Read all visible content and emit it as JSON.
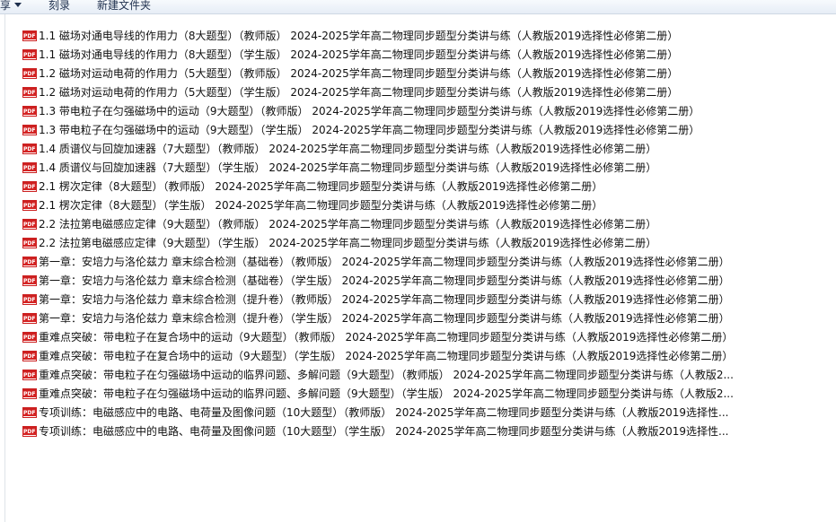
{
  "toolbar": {
    "share_label": "享",
    "burn_label": "刻录",
    "new_folder_label": "新建文件夹"
  },
  "files": [
    {
      "name": "1.1 磁场对通电导线的作用力（8大题型）（教师版） 2024-2025学年高二物理同步题型分类讲与练（人教版2019选择性必修第二册）",
      "icon": "pdf-icon"
    },
    {
      "name": "1.1 磁场对通电导线的作用力（8大题型）（学生版） 2024-2025学年高二物理同步题型分类讲与练（人教版2019选择性必修第二册）",
      "icon": "pdf-icon"
    },
    {
      "name": "1.2 磁场对运动电荷的作用力（5大题型）（教师版） 2024-2025学年高二物理同步题型分类讲与练（人教版2019选择性必修第二册）",
      "icon": "pdf-icon"
    },
    {
      "name": "1.2 磁场对运动电荷的作用力（5大题型）（学生版） 2024-2025学年高二物理同步题型分类讲与练（人教版2019选择性必修第二册）",
      "icon": "pdf-icon"
    },
    {
      "name": "1.3 带电粒子在匀强磁场中的运动（9大题型）（教师版） 2024-2025学年高二物理同步题型分类讲与练（人教版2019选择性必修第二册）",
      "icon": "pdf-icon"
    },
    {
      "name": "1.3 带电粒子在匀强磁场中的运动（9大题型）（学生版） 2024-2025学年高二物理同步题型分类讲与练（人教版2019选择性必修第二册）",
      "icon": "pdf-icon"
    },
    {
      "name": "1.4 质谱仪与回旋加速器（7大题型）（教师版） 2024-2025学年高二物理同步题型分类讲与练（人教版2019选择性必修第二册）",
      "icon": "pdf-icon"
    },
    {
      "name": "1.4 质谱仪与回旋加速器（7大题型）（学生版） 2024-2025学年高二物理同步题型分类讲与练（人教版2019选择性必修第二册）",
      "icon": "pdf-icon"
    },
    {
      "name": "2.1 楞次定律（8大题型）（教师版） 2024-2025学年高二物理同步题型分类讲与练（人教版2019选择性必修第二册）",
      "icon": "pdf-icon"
    },
    {
      "name": "2.1 楞次定律（8大题型）（学生版） 2024-2025学年高二物理同步题型分类讲与练（人教版2019选择性必修第二册）",
      "icon": "pdf-icon"
    },
    {
      "name": "2.2 法拉第电磁感应定律（9大题型）（教师版） 2024-2025学年高二物理同步题型分类讲与练（人教版2019选择性必修第二册）",
      "icon": "pdf-icon"
    },
    {
      "name": "2.2 法拉第电磁感应定律（9大题型）（学生版） 2024-2025学年高二物理同步题型分类讲与练（人教版2019选择性必修第二册）",
      "icon": "pdf-icon"
    },
    {
      "name": "第一章：安培力与洛伦兹力 章末综合检测（基础卷）（教师版） 2024-2025学年高二物理同步题型分类讲与练（人教版2019选择性必修第二册）",
      "icon": "pdf-icon"
    },
    {
      "name": "第一章：安培力与洛伦兹力 章末综合检测（基础卷）（学生版） 2024-2025学年高二物理同步题型分类讲与练（人教版2019选择性必修第二册）",
      "icon": "pdf-icon"
    },
    {
      "name": "第一章：安培力与洛伦兹力 章末综合检测（提升卷）（教师版） 2024-2025学年高二物理同步题型分类讲与练（人教版2019选择性必修第二册）",
      "icon": "pdf-icon"
    },
    {
      "name": "第一章：安培力与洛伦兹力 章末综合检测（提升卷）（学生版） 2024-2025学年高二物理同步题型分类讲与练（人教版2019选择性必修第二册）",
      "icon": "pdf-icon"
    },
    {
      "name": "重难点突破：带电粒子在复合场中的运动（9大题型）（教师版） 2024-2025学年高二物理同步题型分类讲与练（人教版2019选择性必修第二册）",
      "icon": "pdf-icon"
    },
    {
      "name": "重难点突破：带电粒子在复合场中的运动（9大题型）（学生版） 2024-2025学年高二物理同步题型分类讲与练（人教版2019选择性必修第二册）",
      "icon": "pdf-icon"
    },
    {
      "name": "重难点突破：带电粒子在匀强磁场中运动的临界问题、多解问题（9大题型）（教师版） 2024-2025学年高二物理同步题型分类讲与练（人教版2...",
      "icon": "pdf-icon"
    },
    {
      "name": "重难点突破：带电粒子在匀强磁场中运动的临界问题、多解问题（9大题型）（学生版） 2024-2025学年高二物理同步题型分类讲与练（人教版2...",
      "icon": "pdf-icon"
    },
    {
      "name": "专项训练：电磁感应中的电路、电荷量及图像问题（10大题型）（教师版） 2024-2025学年高二物理同步题型分类讲与练（人教版2019选择性...",
      "icon": "pdf-icon"
    },
    {
      "name": "专项训练：电磁感应中的电路、电荷量及图像问题（10大题型）（学生版） 2024-2025学年高二物理同步题型分类讲与练（人教版2019选择性...",
      "icon": "pdf-icon"
    }
  ]
}
